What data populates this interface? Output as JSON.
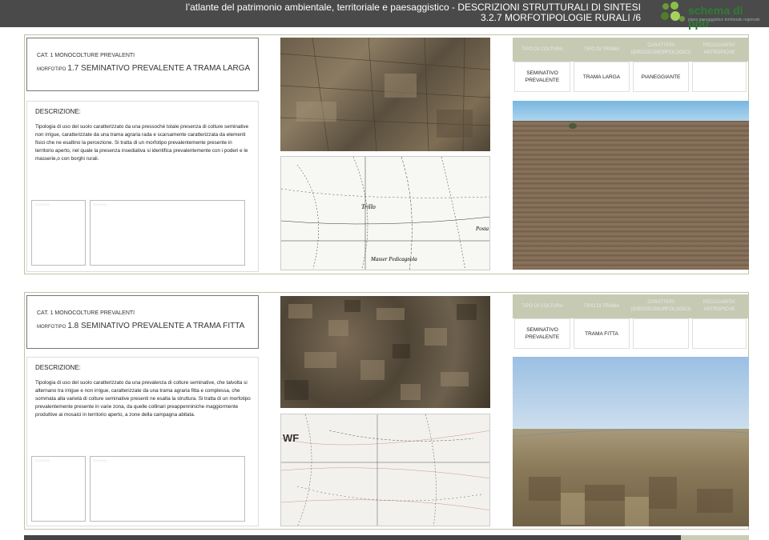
{
  "header": {
    "title_line1": "l’atlante del patrimonio ambientale, territoriale e paesaggistico - DESCRIZIONI STRUTTURALI DI SINTESI",
    "title_line2": "3.2.7 MORFOTIPOLOGIE RURALI /6",
    "logo_text": "schema di pptr",
    "logo_sub": "piano paesaggistico territoriale regionale"
  },
  "table_headers": {
    "tipo_coltura": "TIPO DI COLTURA",
    "tipo_trama": "TIPO DI TRAMA",
    "caratteri": "CARATTERI (IDROGEOMORFOLOGICI)",
    "peculiarita": "PECULIARITA' ANTROPICHE"
  },
  "sections": [
    {
      "cat": "CAT. 1  MONOCOLTURE PREVALENTI",
      "morfotipo_prefix": "MORFOTIPO",
      "morfotipo": "1.7 SEMINATIVO PREVALENTE A TRAMA LARGA",
      "desc_label": "DESCRIZIONE:",
      "description": "Tipologia di uso del suolo caratterizzato da una pressoché totale presenza di colture seminative non irrigue, caratterizzate da una trama agraria rada e scarsamente caratterizzata da elementi fisici che ne esaltino la percezione. Si tratta di un morfotipo prevalentemente presente in territorio aperto, nel quale la presenza insediativa si identifica prevalentemente con i poderi e le masserie,o con borghi rurali.",
      "coltura": "SEMINATIVO PREVALENTE",
      "trama": "TRAMA LARGA",
      "caratteri": "PIANEGGIANTE",
      "peculiarita": "",
      "map_labels": [
        "Trillo",
        "Masser Pedicagnola",
        "Posta"
      ],
      "mini_label_1": "LEGENDA",
      "mini_label_2": "SCHEMA"
    },
    {
      "cat": "CAT. 1  MONOCOLTURE PREVALENTI",
      "morfotipo_prefix": "MORFOTIPO",
      "morfotipo": "1.8 SEMINATIVO PREVALENTE A TRAMA FITTA",
      "desc_label": "DESCRIZIONE:",
      "description": "Tipologia di uso del suolo caratterizzato da una prevalenza di colture seminative, che talvolta si alternano tra irrigue e non irrigue, caratterizzate da una trama agraria fitta e complessa, che sommata alla varietà di colture seminative presenti ne esalta la struttura. Si tratta di un morfotipo prevalentemente presente in varie zona, da quelle collinari preappenniniche maggiormente produttive ai mosaici in territorio aperto, a zone della campagna abitata.",
      "coltura": "SEMINATIVO PREVALENTE",
      "trama": "TRAMA FITTA",
      "caratteri": "",
      "peculiarita": "",
      "map_labels": [
        "WF"
      ],
      "mini_label_1": "LEGENDA",
      "mini_label_2": "SCHEMA"
    }
  ]
}
